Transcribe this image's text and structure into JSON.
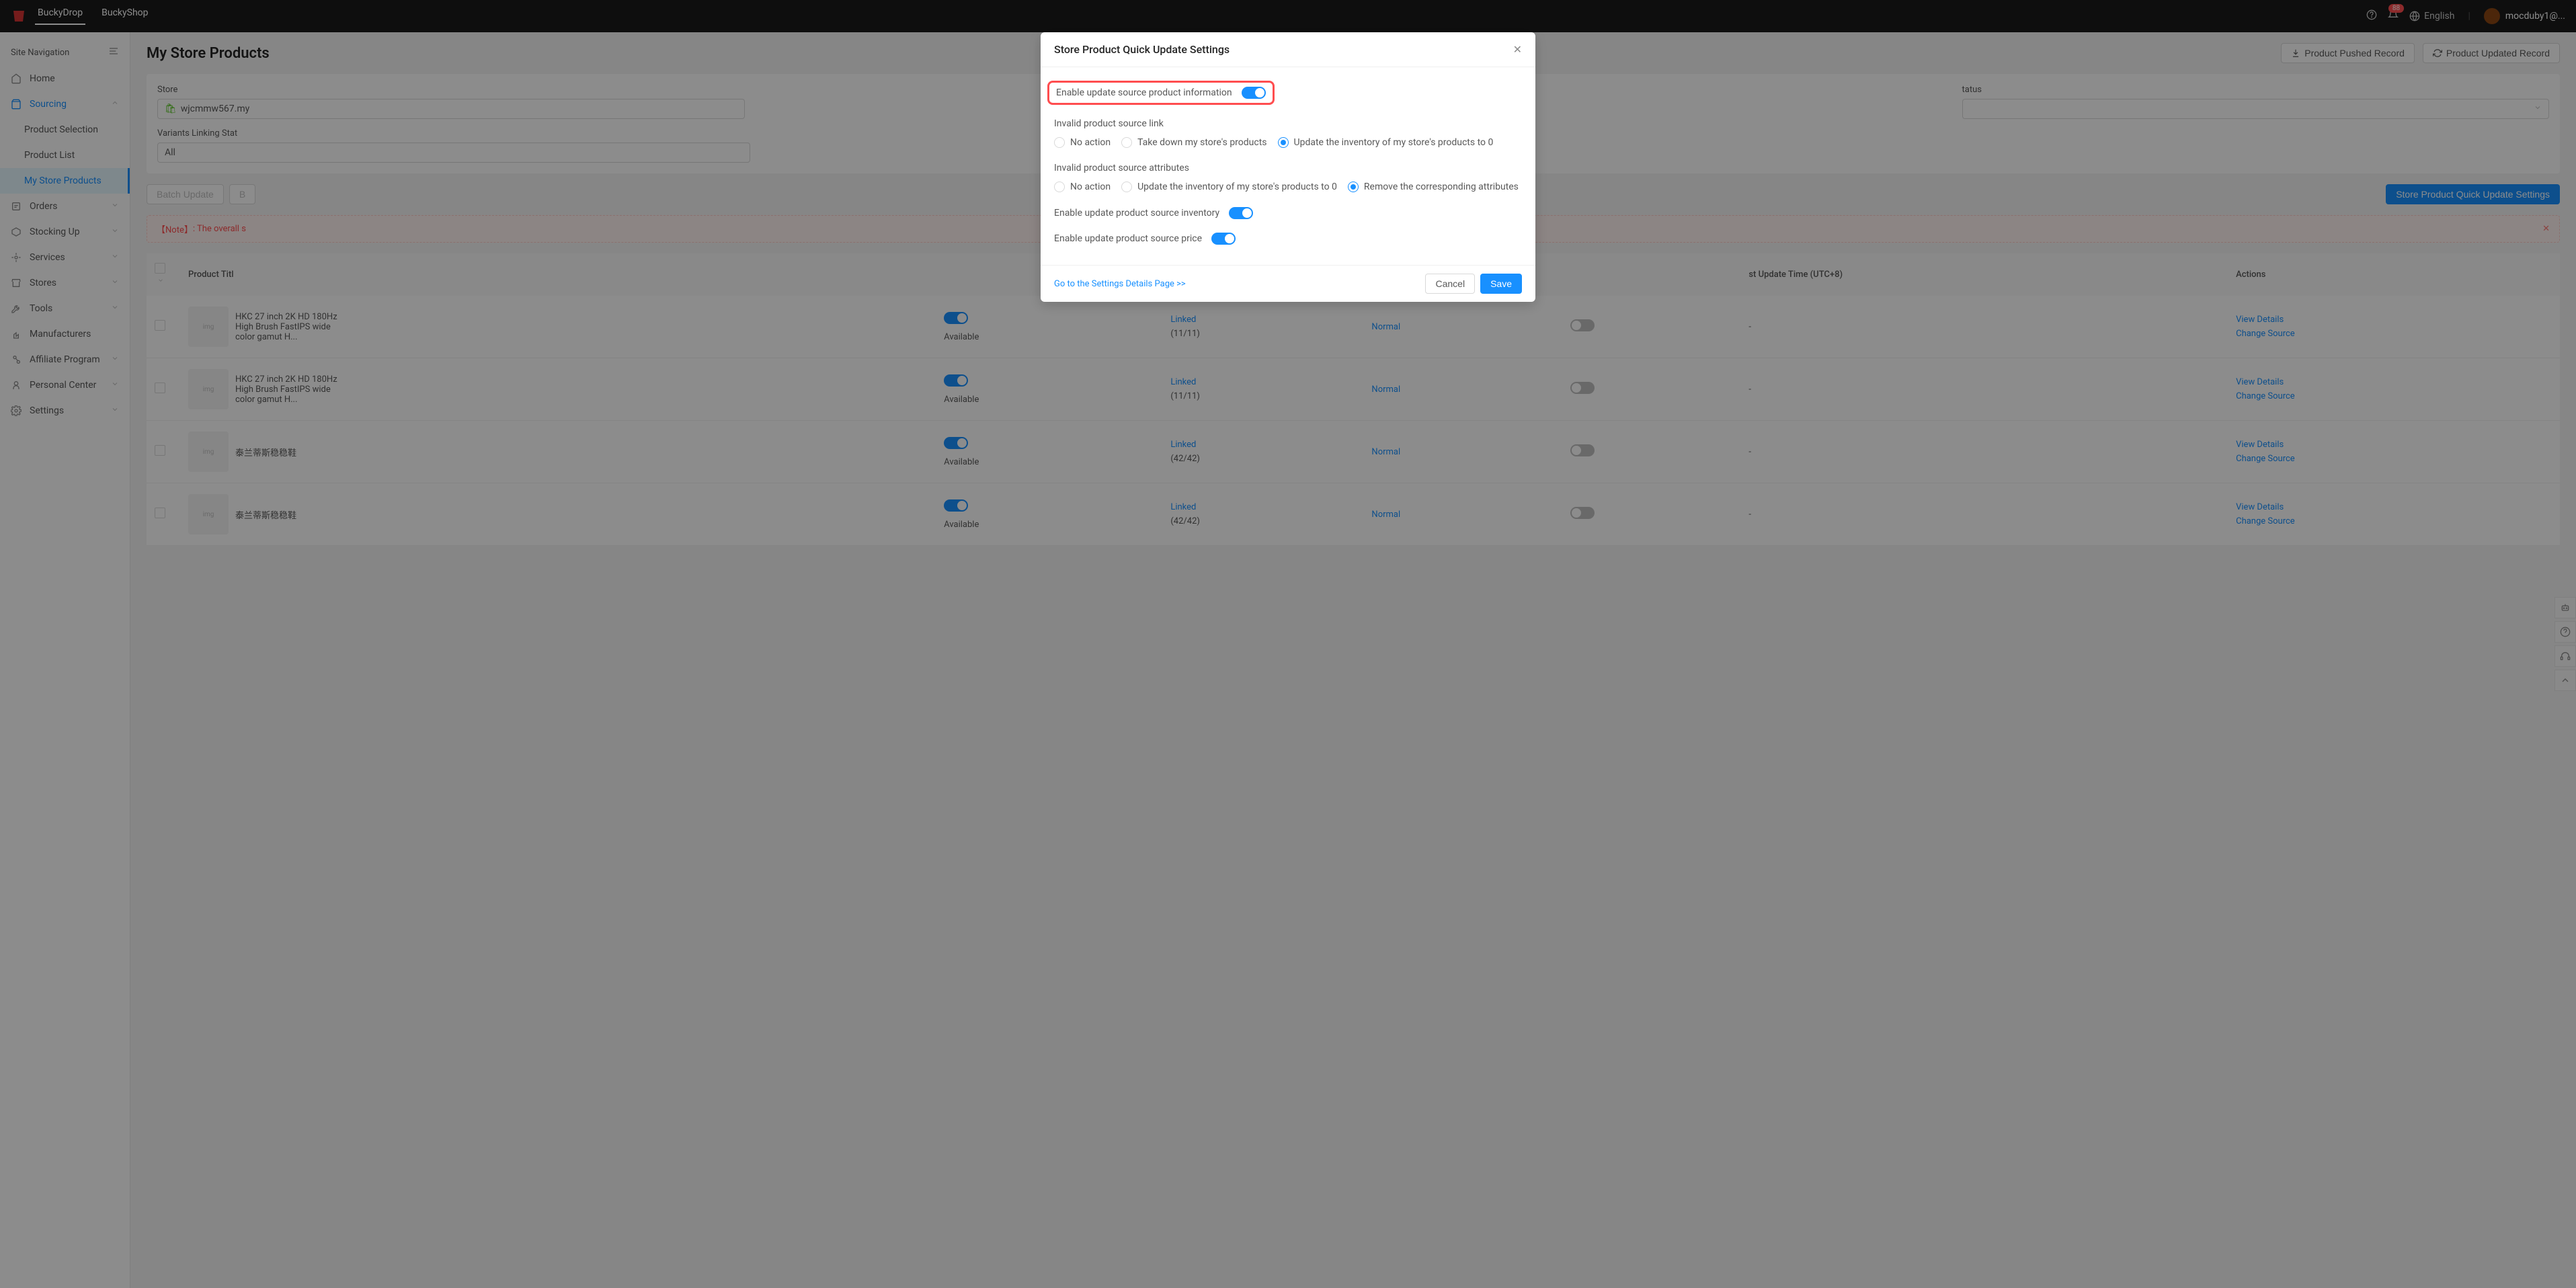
{
  "header": {
    "brand_1": "BuckyDrop",
    "brand_2": "BuckyShop",
    "badge_count": "88",
    "language": "English",
    "user_display": "mocduby1@..."
  },
  "sidebar": {
    "site_nav_label": "Site Navigation",
    "items": [
      {
        "label": "Home"
      },
      {
        "label": "Sourcing",
        "children": [
          {
            "label": "Product Selection"
          },
          {
            "label": "Product List"
          },
          {
            "label": "My Store Products"
          }
        ]
      },
      {
        "label": "Orders"
      },
      {
        "label": "Stocking Up"
      },
      {
        "label": "Services"
      },
      {
        "label": "Stores"
      },
      {
        "label": "Tools"
      },
      {
        "label": "Manufacturers"
      },
      {
        "label": "Affiliate Program"
      },
      {
        "label": "Personal Center"
      },
      {
        "label": "Settings"
      }
    ]
  },
  "page": {
    "title": "My Store Products",
    "pushed_record_btn": "Product Pushed Record",
    "updated_record_btn": "Product Updated Record"
  },
  "filters": {
    "store_label": "Store",
    "store_value": "wjcmmw567.my",
    "status_label": "tatus",
    "variants_label": "Variants Linking Stat",
    "variants_value": "All"
  },
  "actions": {
    "batch_update": "Batch Update",
    "batch_other": "B",
    "quick_settings_btn": "Store Product Quick Update Settings"
  },
  "note": {
    "prefix": "【Note】",
    "text": ": The overall s"
  },
  "table": {
    "headers": {
      "title": "Product Titl",
      "update_time": "st Update Time (UTC+8)",
      "actions": "Actions"
    },
    "action_view": "View Details",
    "action_change": "Change Source",
    "rows": [
      {
        "title": "HKC 27 inch 2K HD 180Hz High Brush FastIPS wide color gamut H...",
        "available": "Available",
        "linked": "Linked",
        "ratio": "(11/11)",
        "normal": "Normal",
        "update_time": "-"
      },
      {
        "title": "HKC 27 inch 2K HD 180Hz High Brush FastIPS wide color gamut H...",
        "available": "Available",
        "linked": "Linked",
        "ratio": "(11/11)",
        "normal": "Normal",
        "update_time": "-"
      },
      {
        "title": "泰兰蒂斯稳稳鞋",
        "available": "Available",
        "linked": "Linked",
        "ratio": "(42/42)",
        "normal": "Normal",
        "update_time": "-"
      },
      {
        "title": "泰兰蒂斯稳稳鞋",
        "available": "Available",
        "linked": "Linked",
        "ratio": "(42/42)",
        "normal": "Normal",
        "update_time": "-"
      }
    ]
  },
  "modal": {
    "title": "Store Product Quick Update Settings",
    "enable_info": "Enable update source product information",
    "invalid_link_label": "Invalid product source link",
    "invalid_link_options": {
      "no_action": "No action",
      "take_down": "Take down my store's products",
      "update_zero": "Update the inventory of my store's products to 0"
    },
    "invalid_attr_label": "Invalid product source attributes",
    "invalid_attr_options": {
      "no_action": "No action",
      "update_zero": "Update the inventory of my store's products to 0",
      "remove": "Remove the corresponding attributes"
    },
    "enable_inventory": "Enable update product source inventory",
    "enable_price": "Enable update product source price",
    "details_link": "Go to the Settings Details Page >>",
    "cancel": "Cancel",
    "save": "Save"
  }
}
